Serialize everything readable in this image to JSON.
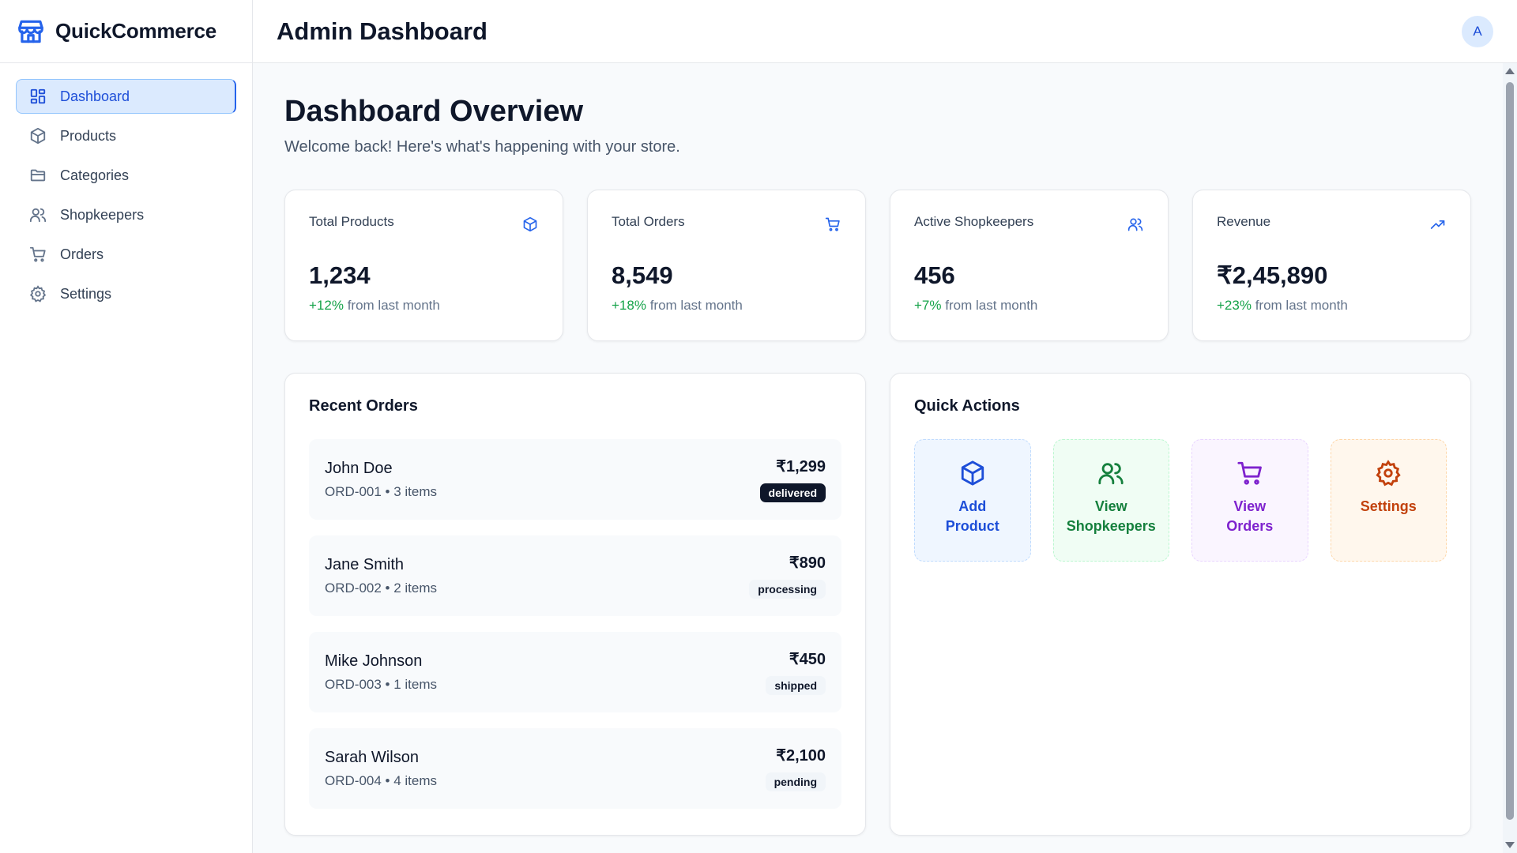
{
  "brand": {
    "name": "QuickCommerce",
    "icon": "store-icon",
    "color": "#2563eb"
  },
  "sidebar": {
    "items": [
      {
        "label": "Dashboard",
        "icon": "layout-grid-icon",
        "active": true
      },
      {
        "label": "Products",
        "icon": "package-icon",
        "active": false
      },
      {
        "label": "Categories",
        "icon": "folder-icon",
        "active": false
      },
      {
        "label": "Shopkeepers",
        "icon": "users-icon",
        "active": false
      },
      {
        "label": "Orders",
        "icon": "cart-icon",
        "active": false
      },
      {
        "label": "Settings",
        "icon": "gear-icon",
        "active": false
      }
    ]
  },
  "header": {
    "title": "Admin Dashboard",
    "avatar_initial": "A"
  },
  "overview": {
    "title": "Dashboard Overview",
    "subtitle": "Welcome back! Here's what's happening with your store."
  },
  "stats": [
    {
      "label": "Total Products",
      "value": "1,234",
      "change": "+12%",
      "suffix": "from last month",
      "icon": "package-icon"
    },
    {
      "label": "Total Orders",
      "value": "8,549",
      "change": "+18%",
      "suffix": "from last month",
      "icon": "cart-icon"
    },
    {
      "label": "Active Shopkeepers",
      "value": "456",
      "change": "+7%",
      "suffix": "from last month",
      "icon": "users-icon"
    },
    {
      "label": "Revenue",
      "value": "₹2,45,890",
      "change": "+23%",
      "suffix": "from last month",
      "icon": "trending-up-icon"
    }
  ],
  "recent_orders": {
    "title": "Recent Orders",
    "orders": [
      {
        "customer": "John Doe",
        "meta": "ORD-001 • 3 items",
        "amount": "₹1,299",
        "status": "delivered"
      },
      {
        "customer": "Jane Smith",
        "meta": "ORD-002 • 2 items",
        "amount": "₹890",
        "status": "processing"
      },
      {
        "customer": "Mike Johnson",
        "meta": "ORD-003 • 1 items",
        "amount": "₹450",
        "status": "shipped"
      },
      {
        "customer": "Sarah Wilson",
        "meta": "ORD-004 • 4 items",
        "amount": "₹2,100",
        "status": "pending"
      }
    ]
  },
  "quick_actions": {
    "title": "Quick Actions",
    "actions": [
      {
        "label_line1": "Add",
        "label_line2": "Product",
        "icon": "package-icon",
        "color": "#1d4ed8",
        "bg": "#eff6ff",
        "border": "#bfdbfe"
      },
      {
        "label_line1": "View",
        "label_line2": "Shopkeepers",
        "icon": "users-icon",
        "color": "#15803d",
        "bg": "#f0fdf4",
        "border": "#bbf7d0"
      },
      {
        "label_line1": "View",
        "label_line2": "Orders",
        "icon": "cart-icon",
        "color": "#7e22ce",
        "bg": "#faf5ff",
        "border": "#e9d5ff"
      },
      {
        "label_line1": "Settings",
        "label_line2": "",
        "icon": "gear-icon",
        "color": "#c2410c",
        "bg": "#fff7ed",
        "border": "#fed7aa"
      }
    ]
  }
}
